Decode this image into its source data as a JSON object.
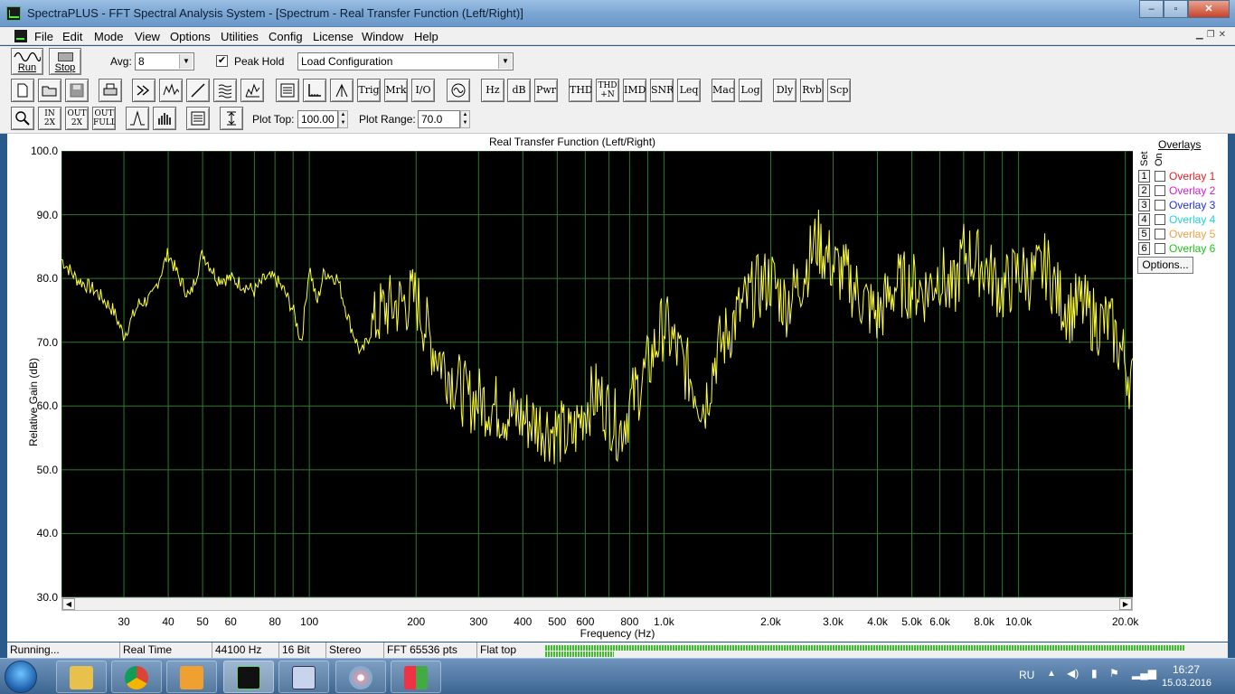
{
  "window": {
    "title": "SpectraPLUS - FFT Spectral Analysis System - [Spectrum - Real Transfer Function (Left/Right)]",
    "controls": [
      "–",
      "▫",
      "✕"
    ]
  },
  "menu": [
    "File",
    "Edit",
    "Mode",
    "View",
    "Options",
    "Utilities",
    "Config",
    "License",
    "Window",
    "Help"
  ],
  "toolbar1": {
    "run_label": "Run",
    "stop_label": "Stop",
    "avg_label": "Avg:",
    "avg_value": "8",
    "peak_hold_label": "Peak Hold",
    "peak_hold_checked": "✔",
    "config_value": "Load Configuration"
  },
  "toolbar2": {
    "text_buttons": [
      "Trig",
      "Mrk",
      "I/O",
      "Hz",
      "dB",
      "Pwr",
      "THD",
      "THD +N",
      "IMD",
      "SNR",
      "Leq",
      "Mac",
      "Log",
      "Dly",
      "Rvb",
      "Scp"
    ]
  },
  "toolbar3": {
    "zoom_in": "IN 2X",
    "zoom_out": "OUT 2X",
    "zoom_full": "OUT FULL",
    "plot_top_label": "Plot Top:",
    "plot_top_value": "100.00",
    "plot_range_label": "Plot Range:",
    "plot_range_value": "70.0"
  },
  "plot": {
    "title": "Real Transfer Function (Left/Right)",
    "ylabel": "Relative Gain (dB)",
    "xlabel": "Frequency (Hz)",
    "y_ticks": [
      "100.0",
      "90.0",
      "80.0",
      "70.0",
      "60.0",
      "50.0",
      "40.0",
      "30.0"
    ],
    "x_ticks": [
      "30",
      "40",
      "50",
      "60",
      "80",
      "100",
      "200",
      "300",
      "400",
      "500",
      "600",
      "800",
      "1.0k",
      "2.0k",
      "3.0k",
      "4.0k",
      "5.0k",
      "6.0k",
      "8.0k",
      "10.0k",
      "20.0k"
    ],
    "colors": {
      "background": "#000000",
      "grid": "#2f7a2f",
      "trace": "#ffff3c"
    }
  },
  "chart_data": {
    "type": "line",
    "title": "Real Transfer Function (Left/Right)",
    "xlabel": "Frequency (Hz)",
    "ylabel": "Relative Gain (dB)",
    "xscale": "log",
    "xlim": [
      20,
      21000
    ],
    "ylim": [
      30,
      100
    ],
    "grid": true,
    "x": [
      20,
      22,
      25,
      28,
      30,
      33,
      36,
      40,
      43,
      46,
      50,
      55,
      60,
      65,
      70,
      75,
      80,
      85,
      90,
      95,
      100,
      105,
      110,
      120,
      130,
      140,
      150,
      160,
      180,
      200,
      220,
      250,
      280,
      300,
      330,
      360,
      400,
      450,
      500,
      550,
      600,
      650,
      700,
      750,
      800,
      900,
      1000,
      1100,
      1200,
      1300,
      1400,
      1600,
      1800,
      2000,
      2200,
      2400,
      2700,
      3000,
      3300,
      3600,
      4000,
      4500,
      5000,
      5500,
      6000,
      6500,
      7000,
      8000,
      9000,
      10000,
      11000,
      12000,
      13000,
      14000,
      15000,
      16000,
      17000,
      18000,
      19000,
      20000,
      21000
    ],
    "y": [
      83,
      80,
      78,
      75,
      71,
      76,
      77,
      84,
      80,
      77,
      84,
      80,
      80,
      79,
      78,
      80,
      80,
      78,
      75,
      70,
      82,
      76,
      81,
      80,
      73,
      68,
      72,
      75,
      76,
      77,
      70,
      65,
      61,
      61,
      60,
      59,
      58,
      57,
      56,
      55,
      60,
      62,
      59,
      56,
      60,
      66,
      73,
      68,
      64,
      60,
      68,
      74,
      78,
      80,
      76,
      79,
      86,
      82,
      80,
      77,
      74,
      79,
      79,
      78,
      81,
      77,
      84,
      82,
      78,
      81,
      80,
      82,
      77,
      75,
      76,
      74,
      73,
      73,
      70,
      67,
      63
    ],
    "series": [
      {
        "name": "Left/Right",
        "color": "#ffff3c"
      }
    ]
  },
  "overlays": {
    "header": "Overlays",
    "set_label": "Set",
    "on_label": "On",
    "items": [
      {
        "num": "1",
        "name": "Overlay 1",
        "color": "#e02020"
      },
      {
        "num": "2",
        "name": "Overlay 2",
        "color": "#d020d0"
      },
      {
        "num": "3",
        "name": "Overlay 3",
        "color": "#2030d0"
      },
      {
        "num": "4",
        "name": "Overlay 4",
        "color": "#20d0e0"
      },
      {
        "num": "5",
        "name": "Overlay 5",
        "color": "#f0a040"
      },
      {
        "num": "6",
        "name": "Overlay 6",
        "color": "#20c020"
      }
    ],
    "options_label": "Options..."
  },
  "status": {
    "state": "Running...",
    "mode": "Real Time",
    "rate": "44100 Hz",
    "bits": "16 Bit",
    "channels": "Stereo",
    "fft": "FFT 65536 pts",
    "window": "Flat top"
  },
  "taskbar": {
    "lang": "RU",
    "time": "16:27",
    "date": "15.03.2016"
  }
}
